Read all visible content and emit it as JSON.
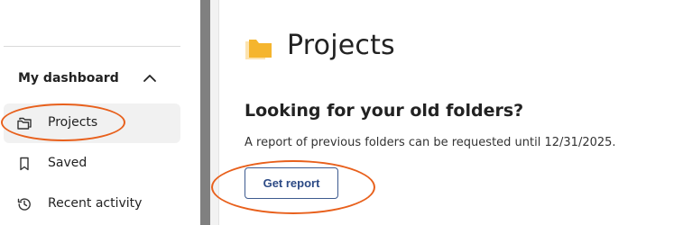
{
  "sidebar": {
    "section_title": "My dashboard",
    "items": [
      {
        "label": "Projects",
        "icon": "folders-icon",
        "active": true
      },
      {
        "label": "Saved",
        "icon": "bookmark-icon",
        "active": false
      },
      {
        "label": "Recent activity",
        "icon": "history-icon",
        "active": false
      }
    ]
  },
  "main": {
    "title": "Projects",
    "title_icon": "folder-icon",
    "heading": "Looking for your old folders?",
    "body": "A report of previous folders can be requested until 12/31/2025.",
    "button_label": "Get report"
  },
  "colors": {
    "accent_folder": "#f5b52e",
    "button_text": "#2c4a85",
    "annotation": "#e8601c"
  }
}
